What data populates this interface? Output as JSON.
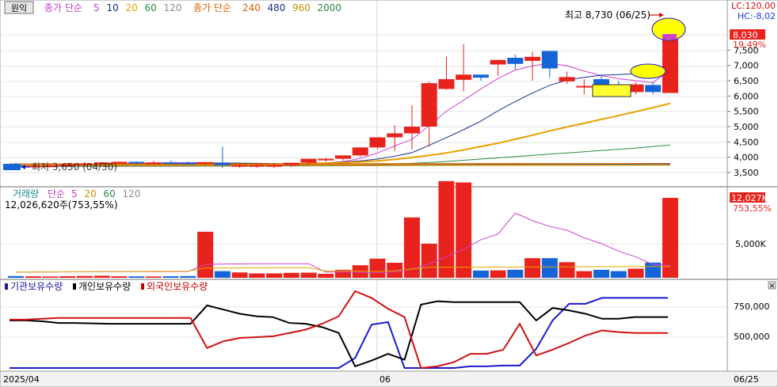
{
  "header": {
    "mode_button": "원익",
    "ma_groups": [
      {
        "label": "종가 단순",
        "color": "#c040c0",
        "periods": [
          {
            "value": "5",
            "color": "#c040c0"
          },
          {
            "value": "10",
            "color": "#1a2e8c"
          },
          {
            "value": "20",
            "color": "#e8a000"
          },
          {
            "value": "60",
            "color": "#2a8a40"
          },
          {
            "value": "120",
            "color": "#8c8c8c"
          }
        ]
      },
      {
        "label": "종가 단순",
        "color": "#e06000",
        "periods": [
          {
            "value": "240",
            "color": "#e06000"
          },
          {
            "value": "480",
            "color": "#1a2e8c"
          },
          {
            "value": "960",
            "color": "#c09000"
          },
          {
            "value": "2000",
            "color": "#2a8a40"
          }
        ]
      }
    ],
    "lc": "LC:120,00",
    "hc": "HC:-8,02"
  },
  "colors": {
    "up": "#e8231d",
    "down": "#1565d8",
    "box": "#ffff00"
  },
  "price_panel": {
    "high_note": "최고 8,730 (06/25)",
    "low_note": "최저 3,650 (04/30)",
    "current_badge": "8,030",
    "change_pct": "19,49%",
    "axis_ticks": [
      "7,500",
      "7,000",
      "6,500",
      "6,000",
      "5,500",
      "5,000",
      "4,500",
      "4,000",
      "3,500"
    ]
  },
  "volume_panel": {
    "title": "거래량",
    "ma_label": "단순",
    "ma_periods": [
      {
        "value": "5",
        "color": "#c040c0"
      },
      {
        "value": "20",
        "color": "#c09000"
      },
      {
        "value": "60",
        "color": "#2a8a40"
      },
      {
        "value": "120",
        "color": "#8c8c8c"
      }
    ],
    "value_text": "12,026,620주(753,55%)",
    "badge": "12,027K",
    "badge_pct": "753,55%",
    "axis_tick": "5,000K"
  },
  "holdings_panel": {
    "legend": [
      {
        "label": "기관보유수량",
        "color": "#1a1aa0"
      },
      {
        "label": "개인보유수량",
        "color": "#000000"
      },
      {
        "label": "외국인보유수량",
        "color": "#c00000"
      }
    ],
    "axis_ticks": [
      "750,000",
      "500,000"
    ],
    "close_glyph": "×"
  },
  "x_axis": {
    "labels": [
      "2025/04",
      "06"
    ],
    "end_label": "06/25"
  },
  "chart_data": {
    "type": "candlestick",
    "x": [
      "04/14",
      "04/15",
      "04/16",
      "04/17",
      "04/18",
      "04/21",
      "04/22",
      "04/23",
      "04/24",
      "04/25",
      "04/28",
      "04/29",
      "04/30",
      "05/02",
      "05/07",
      "05/08",
      "05/09",
      "05/12",
      "05/13",
      "05/14",
      "05/15",
      "05/16",
      "05/19",
      "05/20",
      "05/21",
      "05/22",
      "05/23",
      "05/26",
      "05/27",
      "05/28",
      "05/29",
      "06/02",
      "06/04",
      "06/05",
      "06/09",
      "06/10",
      "06/11",
      "06/12",
      "06/13",
      "06/16",
      "06/17",
      "06/18",
      "06/19",
      "06/20",
      "06/23",
      "06/24",
      "06/25"
    ],
    "series": [
      {
        "name": "가격",
        "open": [
          3720,
          3700,
          3720,
          3730,
          3760,
          3800,
          3830,
          3850,
          3800,
          3830,
          3820,
          3800,
          3800,
          3740,
          3740,
          3740,
          3740,
          3820,
          3950,
          3950,
          4060,
          4320,
          4650,
          4780,
          5000,
          6230,
          6530,
          6700,
          7030,
          7250,
          7150,
          7470,
          6480,
          6330,
          6550,
          6320,
          6130,
          6360,
          6100
        ],
        "high": [
          3820,
          3780,
          3800,
          3820,
          3840,
          3850,
          3860,
          3870,
          3880,
          3890,
          3860,
          3850,
          4350,
          3780,
          3790,
          3790,
          3800,
          3950,
          3980,
          4050,
          4100,
          4650,
          5050,
          5700,
          6470,
          7280,
          7700,
          6620,
          7130,
          7350,
          7450,
          7480,
          6800,
          6550,
          6700,
          6500,
          6450,
          6460,
          6950
        ],
        "low": [
          3680,
          3650,
          3690,
          3690,
          3720,
          3750,
          3780,
          3760,
          3770,
          3790,
          3780,
          3750,
          3650,
          3650,
          3650,
          3640,
          3680,
          3760,
          3850,
          3890,
          4010,
          4270,
          4200,
          4250,
          4350,
          6200,
          6150,
          6500,
          6650,
          6850,
          6500,
          6600,
          6400,
          6050,
          6180,
          6050,
          6050,
          6050,
          6380
        ],
        "close": [
          3700,
          3720,
          3730,
          3760,
          3800,
          3830,
          3850,
          3800,
          3830,
          3820,
          3800,
          3840,
          3740,
          3740,
          3740,
          3740,
          3820,
          3950,
          3950,
          4060,
          4320,
          4650,
          4780,
          5000,
          6420,
          6550,
          6700,
          6600,
          7180,
          7050,
          7280,
          6900,
          6620,
          6330,
          6330,
          6180,
          6380,
          6130,
          8030
        ]
      }
    ],
    "ma": [
      {
        "name": "5",
        "values": [
          3720,
          3722,
          3728,
          3736,
          3749,
          3771,
          3794,
          3803,
          3815,
          3825,
          3823,
          3818,
          3805,
          3790,
          3768,
          3755,
          3752,
          3779,
          3811,
          3858,
          3960,
          4138,
          4370,
          4584,
          5028,
          5504,
          5864,
          6230,
          6576,
          6849,
          6986,
          7069,
          6988,
          6814,
          6667,
          6566,
          6502,
          6440,
          6852
        ]
      },
      {
        "name": "10",
        "values": [
          3720,
          3721,
          3724,
          3730,
          3740,
          3750,
          3760,
          3770,
          3780,
          3790,
          3800,
          3810,
          3810,
          3808,
          3800,
          3791,
          3785,
          3800,
          3814,
          3842,
          3882,
          3940,
          4035,
          4150,
          4390,
          4640,
          4900,
          5180,
          5520,
          5820,
          6100,
          6350,
          6520,
          6610,
          6680,
          6700,
          6730,
          6740,
          6790
        ]
      },
      {
        "name": "20",
        "values": [
          3720,
          3720,
          3721,
          3722,
          3724,
          3728,
          3732,
          3736,
          3740,
          3745,
          3750,
          3754,
          3758,
          3762,
          3768,
          3772,
          3776,
          3790,
          3804,
          3820,
          3845,
          3880,
          3930,
          3990,
          4060,
          4140,
          4240,
          4350,
          4460,
          4590,
          4720,
          4860,
          4990,
          5110,
          5240,
          5360,
          5490,
          5620,
          5760
        ]
      },
      {
        "name": "60",
        "values": [
          3720,
          3720,
          3720,
          3720,
          3720,
          3720,
          3720,
          3720,
          3720,
          3720,
          3720,
          3721,
          3722,
          3722,
          3723,
          3724,
          3724,
          3728,
          3733,
          3740,
          3748,
          3760,
          3780,
          3800,
          3830,
          3860,
          3900,
          3940,
          3980,
          4020,
          4060,
          4100,
          4140,
          4180,
          4220,
          4260,
          4300,
          4350,
          4400
        ]
      }
    ],
    "volume": {
      "values_k": [
        90,
        80,
        70,
        85,
        95,
        110,
        80,
        75,
        70,
        80,
        90,
        2420,
        350,
        280,
        230,
        230,
        260,
        270,
        210,
        420,
        660,
        1005,
        790,
        3170,
        1790,
        5080,
        5010,
        380,
        390,
        420,
        1030,
        1030,
        820,
        350,
        420,
        350,
        480,
        800,
        4200
      ],
      "ma_5": [
        300,
        300,
        300,
        310,
        310,
        320,
        320,
        320,
        320,
        330,
        330,
        700,
        720,
        730,
        740,
        740,
        740,
        740,
        300,
        300,
        280,
        260,
        300,
        460,
        720,
        1100,
        1500,
        2000,
        2300,
        3400,
        3000,
        2700,
        2500,
        2100,
        1800,
        1400,
        1100,
        700,
        650
      ]
    },
    "holdings": {
      "institution": [
        30000,
        30000,
        30000,
        30000,
        30000,
        30000,
        30000,
        30000,
        30000,
        30000,
        30000,
        30000,
        30000,
        30000,
        30000,
        30000,
        30000,
        30000,
        30000,
        30000,
        30000,
        150000,
        550000,
        580000,
        30000,
        30000,
        30000,
        30000,
        50000,
        50000,
        60000,
        60000,
        260000,
        600000,
        800000,
        800000,
        870000,
        870000,
        870000,
        870000,
        870000
      ],
      "individual": [
        600000,
        600000,
        590000,
        570000,
        570000,
        565000,
        560000,
        560000,
        560000,
        560000,
        560000,
        560000,
        780000,
        730000,
        680000,
        650000,
        640000,
        570000,
        560000,
        520000,
        450000,
        50000,
        120000,
        200000,
        130000,
        790000,
        830000,
        820000,
        820000,
        820000,
        820000,
        820000,
        600000,
        750000,
        720000,
        680000,
        620000,
        620000,
        640000,
        640000,
        640000
      ],
      "foreign": [
        610000,
        610000,
        620000,
        630000,
        630000,
        630000,
        630000,
        630000,
        630000,
        630000,
        630000,
        630000,
        270000,
        350000,
        390000,
        400000,
        410000,
        450000,
        490000,
        560000,
        650000,
        950000,
        870000,
        740000,
        640000,
        30000,
        50000,
        100000,
        200000,
        200000,
        250000,
        560000,
        180000,
        250000,
        330000,
        420000,
        480000,
        460000,
        450000,
        450000,
        450000
      ]
    },
    "price_axis": {
      "min": 3500,
      "max": 8000
    },
    "volume_axis_k": {
      "max": 12027
    }
  }
}
